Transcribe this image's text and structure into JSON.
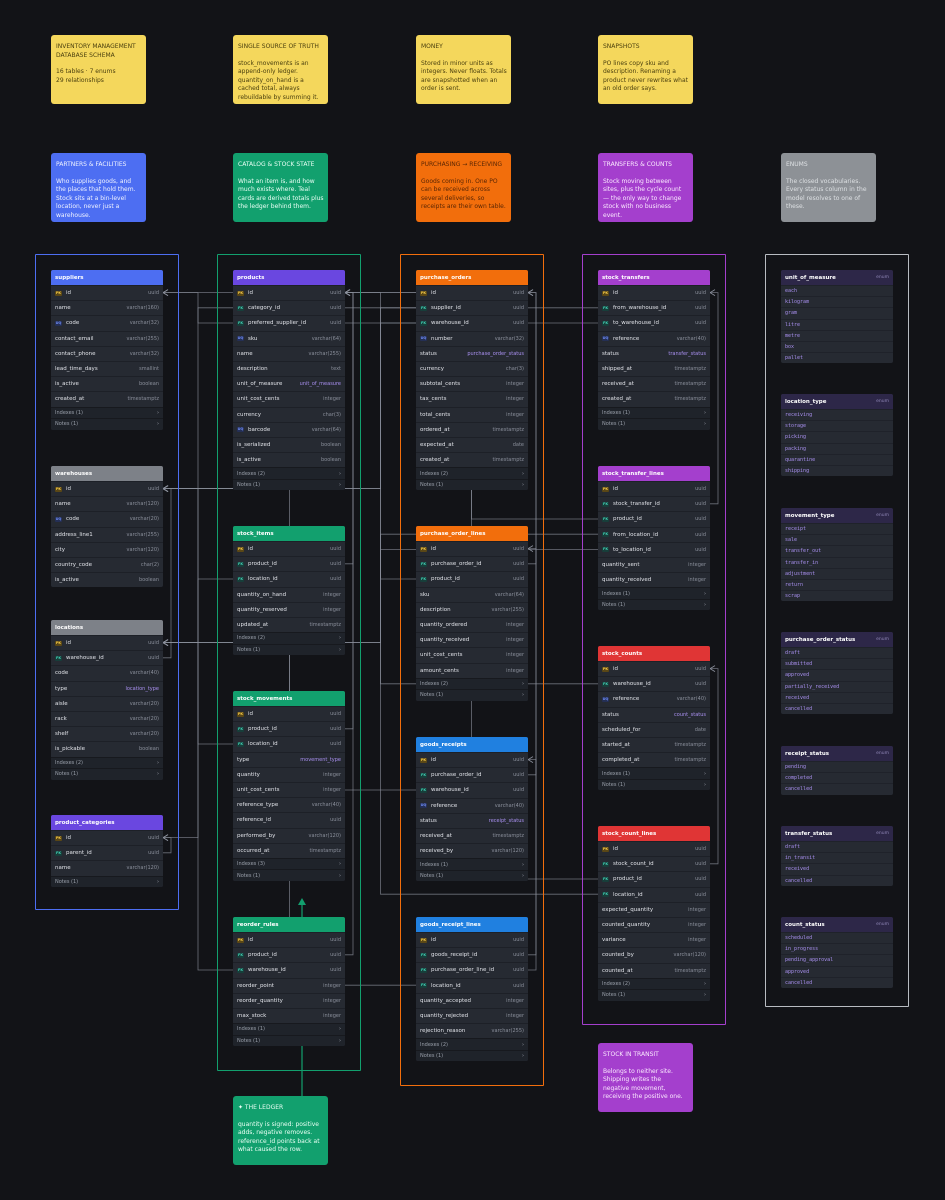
{
  "notes": {
    "schema": {
      "title": "Inventory Management Database Schema",
      "body": "16 tables · 7 enums\n29 relationships"
    },
    "truth": {
      "title": "Single source of truth",
      "body": "stock_movements is an append-only ledger. quantity_on_hand is a cached total, always rebuildable by summing it."
    },
    "money": {
      "title": "Money",
      "body": "Stored in minor units as integers. Never floats. Totals are snapshotted when an order is sent."
    },
    "snapshots": {
      "title": "Snapshots",
      "body": "PO lines copy sku and description. Renaming a product never rewrites what an old order says."
    },
    "partners": {
      "title": "Partners & Facilities",
      "body": "Who supplies goods, and the places that hold them. Stock sits at a bin-level location, never just a warehouse."
    },
    "catalog": {
      "title": "Catalog & Stock State",
      "body": "What an item is, and how much exists where. Teal cards are derived totals plus the ledger behind them."
    },
    "purchasing": {
      "title": "Purchasing → Receiving",
      "body": "Goods coming in. One PO can be received across several deliveries, so receipts are their own table."
    },
    "transfers": {
      "title": "Transfers & Counts",
      "body": "Stock moving between sites, plus the cycle count — the only way to change stock with no business event."
    },
    "enums": {
      "title": "Enums",
      "body": "The closed vocabularies. Every status column in the model resolves to one of these."
    },
    "transit": {
      "title": "Stock in transit",
      "body": "Belongs to neither site. Shipping writes the negative movement, receiving the positive one."
    },
    "ledger": {
      "title": "✦ The ledger",
      "body": "quantity is signed: positive adds, negative removes. reference_id points back at what caused the row."
    }
  },
  "tables": [
    {
      "name": "suppliers",
      "color": "#4d6ef2",
      "fields": [
        [
          "id",
          "uuid",
          "pk"
        ],
        [
          "name",
          "varchar(160)",
          ""
        ],
        [
          "code",
          "varchar(32)",
          "uq"
        ],
        [
          "contact_email",
          "varchar(255)",
          ""
        ],
        [
          "contact_phone",
          "varchar(32)",
          ""
        ],
        [
          "lead_time_days",
          "smallint",
          ""
        ],
        [
          "is_active",
          "boolean",
          ""
        ],
        [
          "created_at",
          "timestamptz",
          ""
        ]
      ],
      "indexes": "Indexes (1)",
      "notes": "Notes (1)"
    },
    {
      "name": "warehouses",
      "color": "#7d8188",
      "fields": [
        [
          "id",
          "uuid",
          "pk"
        ],
        [
          "name",
          "varchar(120)",
          ""
        ],
        [
          "code",
          "varchar(20)",
          "uq"
        ],
        [
          "address_line1",
          "varchar(255)",
          ""
        ],
        [
          "city",
          "varchar(120)",
          ""
        ],
        [
          "country_code",
          "char(2)",
          ""
        ],
        [
          "is_active",
          "boolean",
          ""
        ]
      ],
      "indexes": "",
      "notes": ""
    },
    {
      "name": "locations",
      "color": "#7d8188",
      "fields": [
        [
          "id",
          "uuid",
          "pk"
        ],
        [
          "warehouse_id",
          "uuid",
          "fk"
        ],
        [
          "code",
          "varchar(40)",
          ""
        ],
        [
          "type",
          "location_type",
          "enum"
        ],
        [
          "aisle",
          "varchar(20)",
          ""
        ],
        [
          "rack",
          "varchar(20)",
          ""
        ],
        [
          "shelf",
          "varchar(20)",
          ""
        ],
        [
          "is_pickable",
          "boolean",
          ""
        ]
      ],
      "indexes": "Indexes (2)",
      "notes": "Notes (1)"
    },
    {
      "name": "product_categories",
      "color": "#6a47e0",
      "fields": [
        [
          "id",
          "uuid",
          "pk"
        ],
        [
          "parent_id",
          "uuid",
          "fk"
        ],
        [
          "name",
          "varchar(120)",
          ""
        ]
      ],
      "indexes": "",
      "notes": "Notes (1)"
    },
    {
      "name": "products",
      "color": "#6a47e0",
      "fields": [
        [
          "id",
          "uuid",
          "pk"
        ],
        [
          "category_id",
          "uuid",
          "fk"
        ],
        [
          "preferred_supplier_id",
          "uuid",
          "fk"
        ],
        [
          "sku",
          "varchar(64)",
          "uq"
        ],
        [
          "name",
          "varchar(255)",
          ""
        ],
        [
          "description",
          "text",
          ""
        ],
        [
          "unit_of_measure",
          "unit_of_measure",
          "enum"
        ],
        [
          "unit_cost_cents",
          "integer",
          ""
        ],
        [
          "currency",
          "char(3)",
          ""
        ],
        [
          "barcode",
          "varchar(64)",
          "uq"
        ],
        [
          "is_serialized",
          "boolean",
          ""
        ],
        [
          "is_active",
          "boolean",
          ""
        ]
      ],
      "indexes": "Indexes (2)",
      "notes": "Notes (1)"
    },
    {
      "name": "stock_items",
      "color": "#12a06e",
      "fields": [
        [
          "id",
          "uuid",
          "pk"
        ],
        [
          "product_id",
          "uuid",
          "fk"
        ],
        [
          "location_id",
          "uuid",
          "fk"
        ],
        [
          "quantity_on_hand",
          "integer",
          ""
        ],
        [
          "quantity_reserved",
          "integer",
          ""
        ],
        [
          "updated_at",
          "timestamptz",
          ""
        ]
      ],
      "indexes": "Indexes (2)",
      "notes": "Notes (1)"
    },
    {
      "name": "stock_movements",
      "color": "#12a06e",
      "fields": [
        [
          "id",
          "uuid",
          "pk"
        ],
        [
          "product_id",
          "uuid",
          "fk"
        ],
        [
          "location_id",
          "uuid",
          "fk"
        ],
        [
          "type",
          "movement_type",
          "enum"
        ],
        [
          "quantity",
          "integer",
          ""
        ],
        [
          "unit_cost_cents",
          "integer",
          ""
        ],
        [
          "reference_type",
          "varchar(40)",
          ""
        ],
        [
          "reference_id",
          "uuid",
          ""
        ],
        [
          "performed_by",
          "varchar(120)",
          ""
        ],
        [
          "occurred_at",
          "timestamptz",
          ""
        ]
      ],
      "indexes": "Indexes (3)",
      "notes": "Notes (1)"
    },
    {
      "name": "reorder_rules",
      "color": "#12a06e",
      "fields": [
        [
          "id",
          "uuid",
          "pk"
        ],
        [
          "product_id",
          "uuid",
          "fk"
        ],
        [
          "warehouse_id",
          "uuid",
          "fk"
        ],
        [
          "reorder_point",
          "integer",
          ""
        ],
        [
          "reorder_quantity",
          "integer",
          ""
        ],
        [
          "max_stock",
          "integer",
          ""
        ]
      ],
      "indexes": "Indexes (1)",
      "notes": "Notes (1)"
    },
    {
      "name": "purchase_orders",
      "color": "#f26e0c",
      "fields": [
        [
          "id",
          "uuid",
          "pk"
        ],
        [
          "supplier_id",
          "uuid",
          "fk"
        ],
        [
          "warehouse_id",
          "uuid",
          "fk"
        ],
        [
          "number",
          "varchar(32)",
          "uq"
        ],
        [
          "status",
          "purchase_order_status",
          "enum"
        ],
        [
          "currency",
          "char(3)",
          ""
        ],
        [
          "subtotal_cents",
          "integer",
          ""
        ],
        [
          "tax_cents",
          "integer",
          ""
        ],
        [
          "total_cents",
          "integer",
          ""
        ],
        [
          "ordered_at",
          "timestamptz",
          ""
        ],
        [
          "expected_at",
          "date",
          ""
        ],
        [
          "created_at",
          "timestamptz",
          ""
        ]
      ],
      "indexes": "Indexes (2)",
      "notes": "Notes (1)"
    },
    {
      "name": "purchase_order_lines",
      "color": "#f26e0c",
      "fields": [
        [
          "id",
          "uuid",
          "pk"
        ],
        [
          "purchase_order_id",
          "uuid",
          "fk"
        ],
        [
          "product_id",
          "uuid",
          "fk"
        ],
        [
          "sku",
          "varchar(64)",
          ""
        ],
        [
          "description",
          "varchar(255)",
          ""
        ],
        [
          "quantity_ordered",
          "integer",
          ""
        ],
        [
          "quantity_received",
          "integer",
          ""
        ],
        [
          "unit_cost_cents",
          "integer",
          ""
        ],
        [
          "amount_cents",
          "integer",
          ""
        ]
      ],
      "indexes": "Indexes (2)",
      "notes": "Notes (1)"
    },
    {
      "name": "goods_receipts",
      "color": "#2080e0",
      "fields": [
        [
          "id",
          "uuid",
          "pk"
        ],
        [
          "purchase_order_id",
          "uuid",
          "fk"
        ],
        [
          "warehouse_id",
          "uuid",
          "fk"
        ],
        [
          "reference",
          "varchar(40)",
          "uq"
        ],
        [
          "status",
          "receipt_status",
          "enum"
        ],
        [
          "received_at",
          "timestamptz",
          ""
        ],
        [
          "received_by",
          "varchar(120)",
          ""
        ]
      ],
      "indexes": "Indexes (1)",
      "notes": "Notes (1)"
    },
    {
      "name": "goods_receipt_lines",
      "color": "#2080e0",
      "fields": [
        [
          "id",
          "uuid",
          "pk"
        ],
        [
          "goods_receipt_id",
          "uuid",
          "fk"
        ],
        [
          "purchase_order_line_id",
          "uuid",
          "fk"
        ],
        [
          "location_id",
          "uuid",
          "fk"
        ],
        [
          "quantity_accepted",
          "integer",
          ""
        ],
        [
          "quantity_rejected",
          "integer",
          ""
        ],
        [
          "rejection_reason",
          "varchar(255)",
          ""
        ]
      ],
      "indexes": "Indexes (2)",
      "notes": "Notes (1)"
    },
    {
      "name": "stock_transfers",
      "color": "#a43fcd",
      "fields": [
        [
          "id",
          "uuid",
          "pk"
        ],
        [
          "from_warehouse_id",
          "uuid",
          "fk"
        ],
        [
          "to_warehouse_id",
          "uuid",
          "fk"
        ],
        [
          "reference",
          "varchar(40)",
          "uq"
        ],
        [
          "status",
          "transfer_status",
          "enum"
        ],
        [
          "shipped_at",
          "timestamptz",
          ""
        ],
        [
          "received_at",
          "timestamptz",
          ""
        ],
        [
          "created_at",
          "timestamptz",
          ""
        ]
      ],
      "indexes": "Indexes (1)",
      "notes": "Notes (1)"
    },
    {
      "name": "stock_transfer_lines",
      "color": "#a43fcd",
      "fields": [
        [
          "id",
          "uuid",
          "pk"
        ],
        [
          "stock_transfer_id",
          "uuid",
          "fk"
        ],
        [
          "product_id",
          "uuid",
          "fk"
        ],
        [
          "from_location_id",
          "uuid",
          "fk"
        ],
        [
          "to_location_id",
          "uuid",
          "fk"
        ],
        [
          "quantity_sent",
          "integer",
          ""
        ],
        [
          "quantity_received",
          "integer",
          ""
        ]
      ],
      "indexes": "Indexes (1)",
      "notes": "Notes (1)"
    },
    {
      "name": "stock_counts",
      "color": "#e03535",
      "fields": [
        [
          "id",
          "uuid",
          "pk"
        ],
        [
          "warehouse_id",
          "uuid",
          "fk"
        ],
        [
          "reference",
          "varchar(40)",
          "uq"
        ],
        [
          "status",
          "count_status",
          "enum"
        ],
        [
          "scheduled_for",
          "date",
          ""
        ],
        [
          "started_at",
          "timestamptz",
          ""
        ],
        [
          "completed_at",
          "timestamptz",
          ""
        ]
      ],
      "indexes": "Indexes (1)",
      "notes": "Notes (1)"
    },
    {
      "name": "stock_count_lines",
      "color": "#e03535",
      "fields": [
        [
          "id",
          "uuid",
          "pk"
        ],
        [
          "stock_count_id",
          "uuid",
          "fk"
        ],
        [
          "product_id",
          "uuid",
          "fk"
        ],
        [
          "location_id",
          "uuid",
          "fk"
        ],
        [
          "expected_quantity",
          "integer",
          ""
        ],
        [
          "counted_quantity",
          "integer",
          ""
        ],
        [
          "variance",
          "integer",
          ""
        ],
        [
          "counted_by",
          "varchar(120)",
          ""
        ],
        [
          "counted_at",
          "timestamptz",
          ""
        ]
      ],
      "indexes": "Indexes (2)",
      "notes": "Notes (1)"
    }
  ],
  "enum_tag": "enum",
  "enums": [
    {
      "name": "unit_of_measure",
      "values": [
        "each",
        "kilogram",
        "gram",
        "litre",
        "metre",
        "box",
        "pallet"
      ]
    },
    {
      "name": "location_type",
      "values": [
        "receiving",
        "storage",
        "picking",
        "packing",
        "quarantine",
        "shipping"
      ]
    },
    {
      "name": "movement_type",
      "values": [
        "receipt",
        "sale",
        "transfer_out",
        "transfer_in",
        "adjustment",
        "return",
        "scrap"
      ]
    },
    {
      "name": "purchase_order_status",
      "values": [
        "draft",
        "submitted",
        "approved",
        "partially_received",
        "received",
        "cancelled"
      ]
    },
    {
      "name": "receipt_status",
      "values": [
        "pending",
        "completed",
        "cancelled"
      ]
    },
    {
      "name": "transfer_status",
      "values": [
        "draft",
        "in_transit",
        "received",
        "cancelled"
      ]
    },
    {
      "name": "count_status",
      "values": [
        "scheduled",
        "in_progress",
        "pending_approval",
        "approved",
        "cancelled"
      ]
    }
  ],
  "colors": {
    "link": "#8b909c",
    "ledger_arrow": "#12a06e"
  }
}
